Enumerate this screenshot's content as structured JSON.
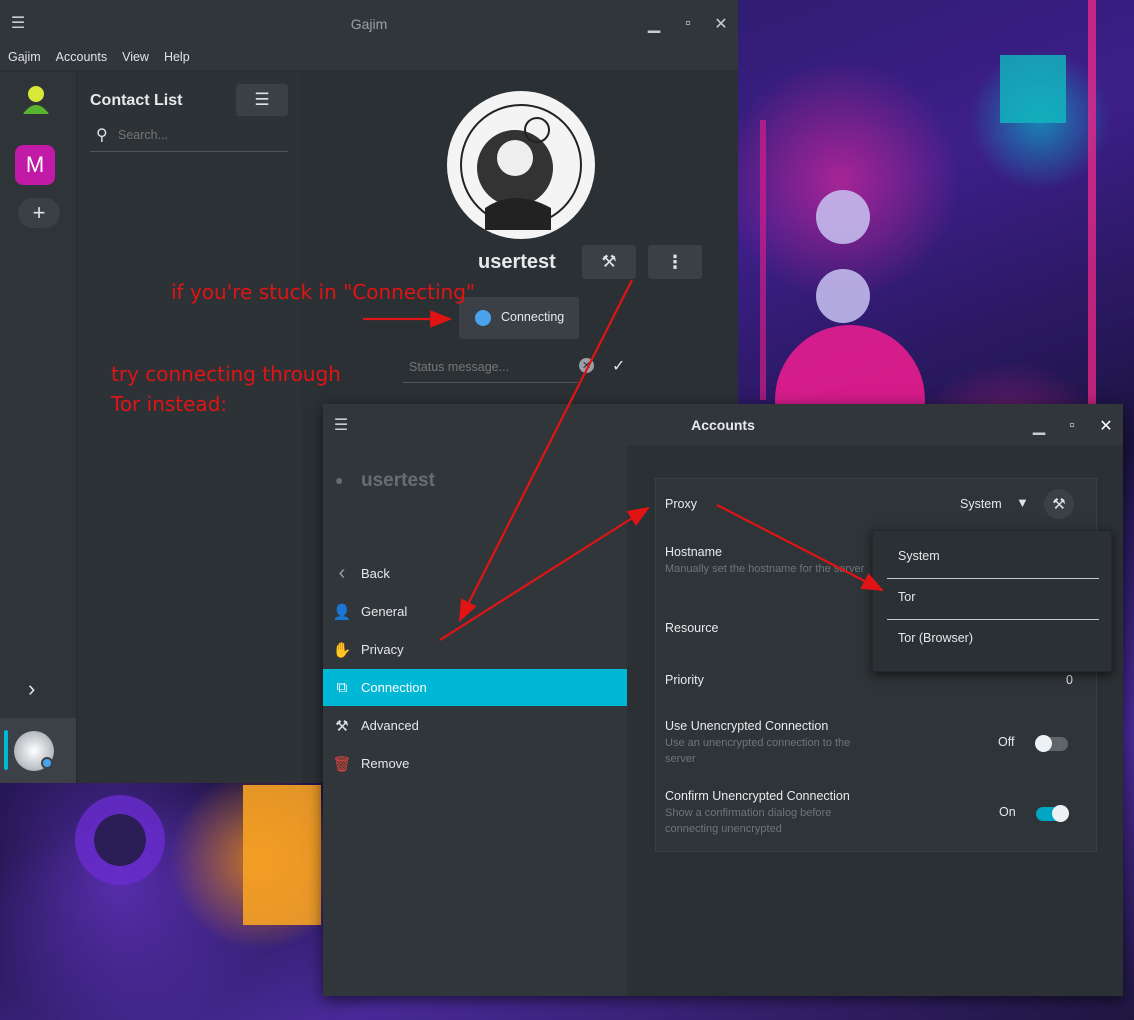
{
  "main_window": {
    "title": "Gajim",
    "menu": [
      "Gajim",
      "Accounts",
      "View",
      "Help"
    ],
    "account_bar": {
      "account_letter": "M"
    },
    "contact_list": {
      "title": "Contact List",
      "search_placeholder": "Search..."
    },
    "profile": {
      "username": "usertest",
      "status_label": "Connecting",
      "status_placeholder": "Status message..."
    }
  },
  "accounts_window": {
    "title": "Accounts",
    "account_name": "usertest",
    "nav": [
      {
        "label": "Back",
        "icon": "chevron-left-icon"
      },
      {
        "label": "General",
        "icon": "person-icon"
      },
      {
        "label": "Privacy",
        "icon": "hand-icon"
      },
      {
        "label": "Connection",
        "icon": "network-icon",
        "selected": true
      },
      {
        "label": "Advanced",
        "icon": "tools-icon"
      },
      {
        "label": "Remove",
        "icon": "trash-icon"
      }
    ],
    "settings": {
      "proxy": {
        "label": "Proxy",
        "value": "System"
      },
      "hostname": {
        "label": "Hostname",
        "sub": "Manually set the hostname for the server"
      },
      "resource": {
        "label": "Resource"
      },
      "priority": {
        "label": "Priority",
        "value": "0"
      },
      "unencrypted": {
        "label": "Use Unencrypted Connection",
        "sub": "Use an unencrypted connection to the server",
        "state": "Off"
      },
      "confirm_unencrypted": {
        "label": "Confirm Unencrypted Connection",
        "sub": "Show a confirmation dialog before connecting unencrypted",
        "state": "On"
      }
    },
    "proxy_options": [
      "System",
      "Tor",
      "Tor (Browser)"
    ]
  },
  "annotations": {
    "line1": "if you're stuck in \"Connecting\"",
    "line2": "try connecting through",
    "line3": "Tor instead:"
  },
  "colors": {
    "accent": "#00b7d6",
    "status_dot": "#4ba3ee",
    "annotation": "#e01414",
    "remove_icon": "#e0443c",
    "avatar_m": "#c01aa6"
  }
}
